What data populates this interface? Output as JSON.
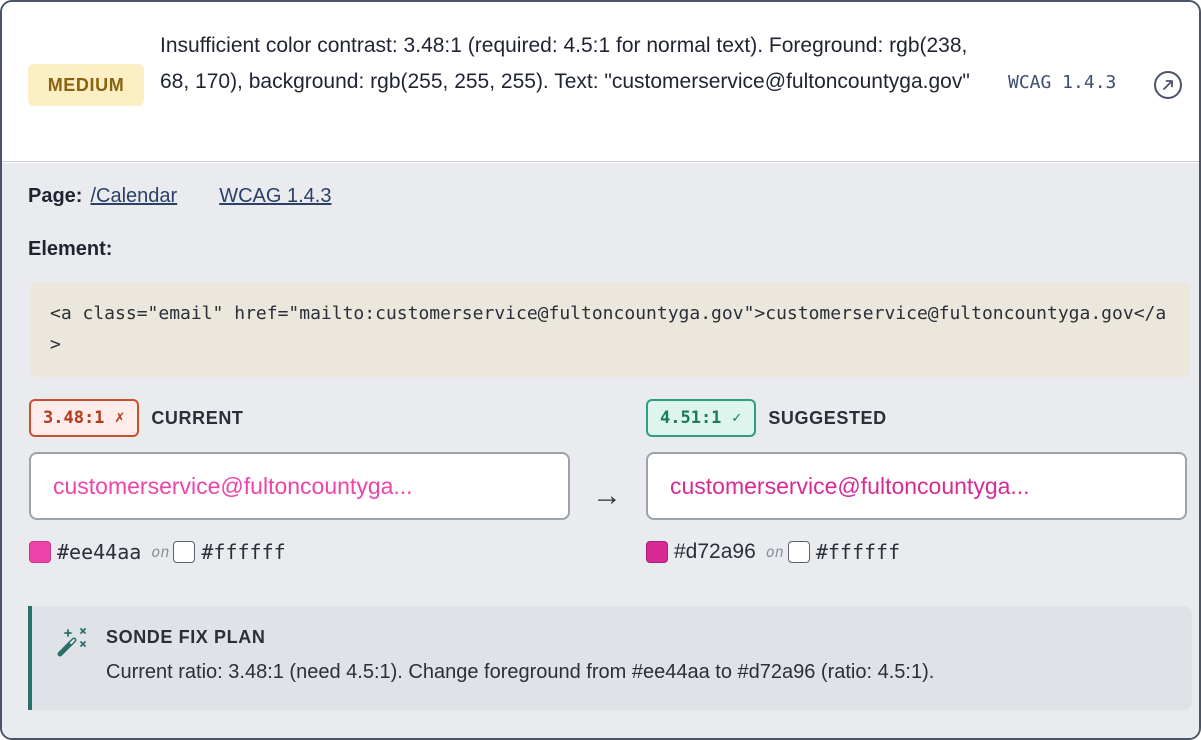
{
  "issue": {
    "severity": "MEDIUM",
    "description": "Insufficient color contrast: 3.48:1 (required: 4.5:1 for normal text). Foreground: rgb(238, 68, 170), background: rgb(255, 255, 255). Text: \"customerservice@fultoncountyga.gov\"",
    "wcag_ref": "WCAG 1.4.3",
    "link_icon": "external-link-icon"
  },
  "details": {
    "page_label": "Page:",
    "page_link": "/Calendar",
    "wcag_link": "WCAG 1.4.3",
    "element_label": "Element:",
    "element_code": "<a class=\"email\" href=\"mailto:customerservice@fultoncountyga.gov\">customerservice@fultoncountyga.gov</a>"
  },
  "current": {
    "ratio": "3.48:1",
    "status_mark": "✗",
    "title": "CURRENT",
    "preview_text": "customerservice@fultoncountyga...",
    "foreground": "#ee44aa",
    "on_text": "on",
    "background": "#ffffff"
  },
  "suggested": {
    "ratio": "4.51:1",
    "status_mark": "✓",
    "title": "SUGGESTED",
    "preview_text": "customerservice@fultoncountyga...",
    "foreground": "#d72a96",
    "on_text": "on",
    "background": "#ffffff"
  },
  "arrow": "→",
  "fix_plan": {
    "icon": "magic-wand-icon",
    "title": "SONDE FIX PLAN",
    "text": "Current ratio: 3.48:1 (need 4.5:1). Change foreground from #ee44aa to #d72a96 (ratio: 4.5:1)."
  },
  "colors": {
    "severity_bg": "#fbefc3",
    "severity_text": "#8a6210",
    "bad": "#c8502e",
    "good": "#2f9e7e",
    "accent": "#2b6f6a"
  }
}
